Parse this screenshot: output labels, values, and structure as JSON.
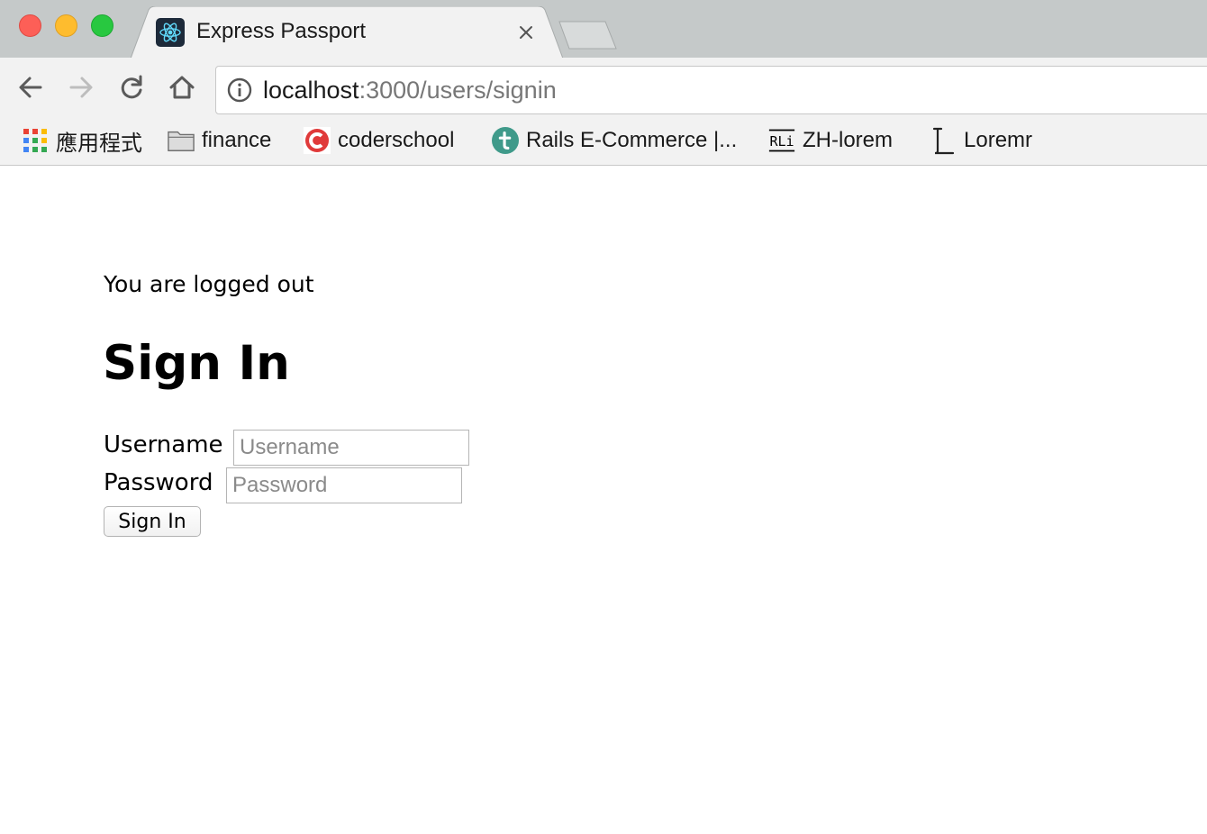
{
  "browser": {
    "tab": {
      "title": "Express Passport",
      "favicon": "react-atom-icon"
    },
    "address_bar": {
      "host": "localhost",
      "path": ":3000/users/signin"
    },
    "bookmarks": [
      {
        "label": "應用程式",
        "icon": "apps-grid-icon"
      },
      {
        "label": "finance",
        "icon": "folder-icon"
      },
      {
        "label": "coderschool",
        "icon": "coderschool-logo-icon"
      },
      {
        "label": "Rails E-Commerce |...",
        "icon": "t-logo-icon"
      },
      {
        "label": "ZH-lorem",
        "icon": "rli-logo-icon"
      },
      {
        "label": "Loremr",
        "icon": "l-logo-icon"
      }
    ],
    "colors": {
      "tabstrip": "#c5c9c9",
      "toolbar": "#f2f2f2",
      "close": "#fd5f57",
      "minimize": "#febc2e",
      "maximize": "#28c840"
    }
  },
  "page": {
    "message": "You are logged out",
    "title": "Sign In",
    "form": {
      "username_label": "Username",
      "username_placeholder": "Username",
      "password_label": "Password",
      "password_placeholder": "Password",
      "submit_label": "Sign In"
    }
  }
}
